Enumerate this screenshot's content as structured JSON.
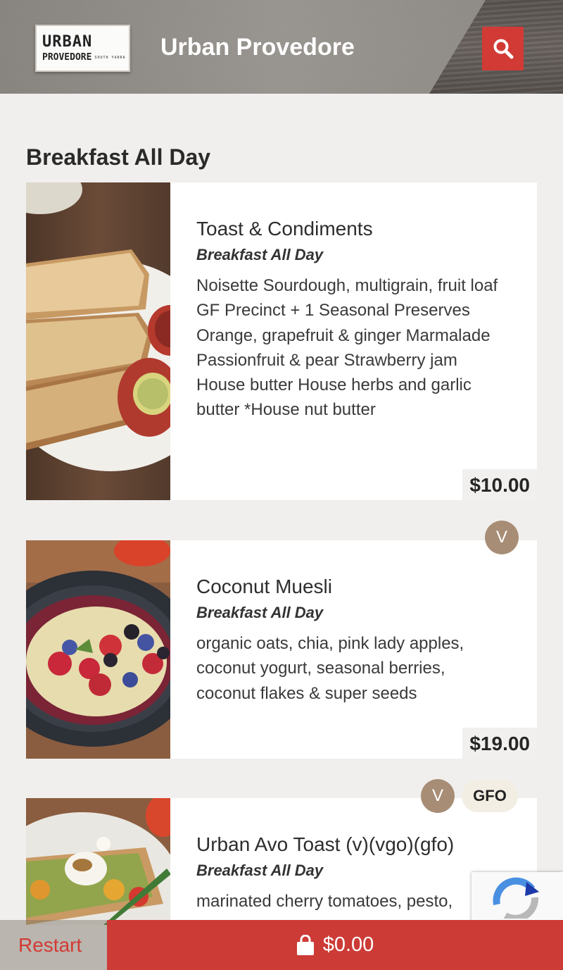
{
  "header": {
    "logo_top": "URBAN",
    "logo_bottom": "PROVEDORE",
    "logo_sub": "SOUTH YARRA",
    "title": "Urban Provedore",
    "search_icon": "search-icon"
  },
  "section": {
    "title": "Breakfast All Day"
  },
  "items": [
    {
      "name": "Toast & Condiments",
      "category": "Breakfast All Day",
      "description": "Noisette Sourdough, multigrain, fruit loaf GF Precinct + 1 Seasonal Preserves Orange, grapefruit & ginger Marmalade Passionfruit & pear Strawberry jam House butter House herbs and garlic butter *House nut butter",
      "price": "$10.00",
      "badges": []
    },
    {
      "name": "Coconut Muesli",
      "category": "Breakfast All Day",
      "description": "organic oats, chia, pink lady apples, coconut yogurt, seasonal berries, coconut flakes & super seeds",
      "price": "$19.00",
      "badges": [
        "V"
      ]
    },
    {
      "name": "Urban Avo Toast (v)(vgo)(gfo)",
      "category": "Breakfast All Day",
      "description": "marinated cherry tomatoes, pesto,",
      "price": "",
      "badges": [
        "V",
        "GFO"
      ]
    }
  ],
  "bottom": {
    "restart_label": "Restart",
    "cart_total": "$0.00",
    "cart_icon": "shopping-bag-icon"
  },
  "colors": {
    "accent_red": "#d23a35",
    "badge_v": "#a88d76",
    "badge_gfo": "#f3eee4",
    "page_bg": "#f0efed"
  }
}
